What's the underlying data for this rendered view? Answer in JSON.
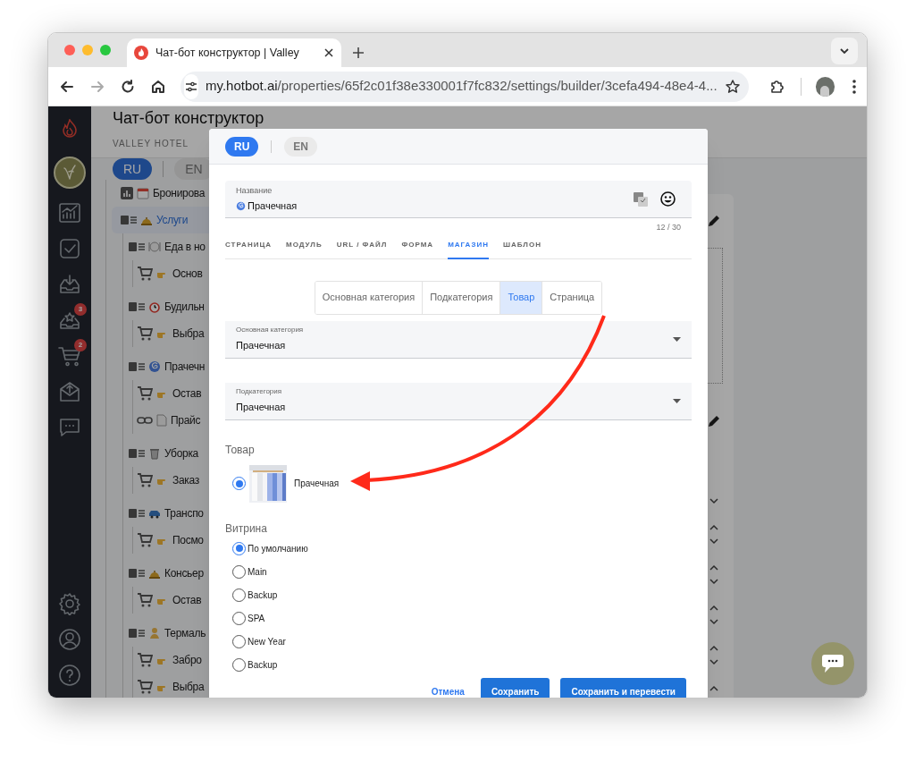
{
  "browser": {
    "tab": {
      "title": "Чат-бот конструктор | Valley"
    },
    "url": {
      "domain": "my.hotbot.ai",
      "path": "/properties/65f2c01f38e330001f7fc832/settings/builder/3cefa494-48e4-4..."
    }
  },
  "sidebar": {
    "badges": [
      "3",
      "2"
    ]
  },
  "page": {
    "title": "Чат-бот конструктор",
    "subtitle": "VALLEY HOTEL",
    "languages": [
      {
        "label": "RU",
        "selected": true
      },
      {
        "label": "EN",
        "selected": false
      }
    ]
  },
  "tree": [
    {
      "label": "Бронирова",
      "kind": "stats",
      "selected": false
    },
    {
      "label": "Услуги",
      "kind": "page",
      "selected": true,
      "children": [
        {
          "label": "Еда в но",
          "kind": "page",
          "selected": false,
          "children": [
            {
              "label": "Основ",
              "kind": "product",
              "selected": false
            }
          ]
        },
        {
          "label": "Будильн",
          "kind": "page",
          "selected": false,
          "children": [
            {
              "label": "Выбра",
              "kind": "product",
              "selected": false
            }
          ]
        },
        {
          "label": "Прачечн",
          "kind": "page",
          "selected": false,
          "children": [
            {
              "label": "Остав",
              "kind": "product",
              "selected": false
            },
            {
              "label": "Прайс",
              "kind": "link",
              "selected": false
            }
          ]
        },
        {
          "label": "Уборка",
          "kind": "page",
          "selected": false,
          "children": [
            {
              "label": "Заказ",
              "kind": "product",
              "selected": false
            }
          ]
        },
        {
          "label": "Транспо",
          "kind": "page",
          "selected": false,
          "children": [
            {
              "label": "Посмо",
              "kind": "product",
              "selected": false
            }
          ]
        },
        {
          "label": "Консьер",
          "kind": "page",
          "selected": false,
          "children": [
            {
              "label": "Остав",
              "kind": "product",
              "selected": false
            }
          ]
        },
        {
          "label": "Термаль",
          "kind": "page",
          "selected": false,
          "children": [
            {
              "label": "Забро",
              "kind": "product",
              "selected": false
            },
            {
              "label": "Выбра",
              "kind": "product",
              "selected": false
            }
          ]
        }
      ]
    }
  ],
  "modal": {
    "languages": [
      {
        "label": "RU",
        "selected": true
      },
      {
        "label": "EN",
        "selected": false
      }
    ],
    "name_field": {
      "label": "Название",
      "value": "Прачечная",
      "counter": "12 / 30"
    },
    "tabs": [
      {
        "label": "СТРАНИЦА",
        "selected": false
      },
      {
        "label": "МОДУЛЬ",
        "selected": false
      },
      {
        "label": "URL / ФАЙЛ",
        "selected": false
      },
      {
        "label": "ФОРМА",
        "selected": false
      },
      {
        "label": "МАГАЗИН",
        "selected": true
      },
      {
        "label": "ШАБЛОН",
        "selected": false
      }
    ],
    "segments": [
      {
        "label": "Основная категория",
        "selected": false
      },
      {
        "label": "Подкатегория",
        "selected": false
      },
      {
        "label": "Товар",
        "selected": true
      },
      {
        "label": "Страница",
        "selected": false
      }
    ],
    "selects": [
      {
        "label": "Основная категория",
        "value": "Прачечная"
      },
      {
        "label": "Подкатегория",
        "value": "Прачечная"
      }
    ],
    "product": {
      "heading": "Товар",
      "items": [
        {
          "label": "Прачечная",
          "selected": true,
          "kind": "picture"
        }
      ]
    },
    "showcase": {
      "heading": "Витрина",
      "options": [
        {
          "label": "По умолчанию",
          "selected": true
        },
        {
          "label": "Main",
          "selected": false
        },
        {
          "label": "Backup",
          "selected": false
        },
        {
          "label": "SPA",
          "selected": false
        },
        {
          "label": "New Year",
          "selected": false
        },
        {
          "label": "Backup",
          "selected": false
        }
      ]
    },
    "buttons": [
      {
        "label": "Отмена",
        "kind": "text"
      },
      {
        "label": "Сохранить",
        "kind": "primary"
      },
      {
        "label": "Сохранить и перевести",
        "kind": "primary"
      }
    ]
  }
}
